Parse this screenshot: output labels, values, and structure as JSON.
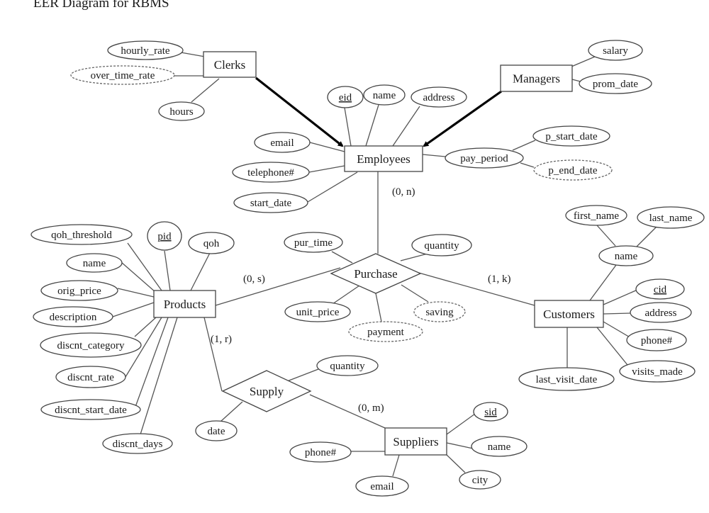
{
  "title": "EER Diagram for RBMS",
  "entities": [
    {
      "id": "clerks",
      "label": "Clerks"
    },
    {
      "id": "managers",
      "label": "Managers"
    },
    {
      "id": "employees",
      "label": "Employees"
    },
    {
      "id": "products",
      "label": "Products"
    },
    {
      "id": "customers",
      "label": "Customers"
    },
    {
      "id": "suppliers",
      "label": "Suppliers"
    }
  ],
  "relationships": [
    {
      "id": "purchase",
      "label": "Purchase",
      "connects": [
        "products",
        "employees",
        "customers"
      ]
    },
    {
      "id": "supply",
      "label": "Supply",
      "connects": [
        "products",
        "suppliers"
      ]
    }
  ],
  "specializations": [
    {
      "from": "clerks",
      "to": "employees"
    },
    {
      "from": "managers",
      "to": "employees"
    }
  ],
  "attributes": [
    {
      "id": "clerks-hourly_rate",
      "owner": "clerks",
      "label": "hourly_rate",
      "key": false,
      "derived": false
    },
    {
      "id": "clerks-over_time_rate",
      "owner": "clerks",
      "label": "over_time_rate",
      "key": false,
      "derived": true
    },
    {
      "id": "clerks-hours",
      "owner": "clerks",
      "label": "hours",
      "key": false,
      "derived": false
    },
    {
      "id": "managers-salary",
      "owner": "managers",
      "label": "salary",
      "key": false,
      "derived": false
    },
    {
      "id": "managers-prom_date",
      "owner": "managers",
      "label": "prom_date",
      "key": false,
      "derived": false
    },
    {
      "id": "employees-eid",
      "owner": "employees",
      "label": "eid",
      "key": true,
      "derived": false
    },
    {
      "id": "employees-name",
      "owner": "employees",
      "label": "name",
      "key": false,
      "derived": false
    },
    {
      "id": "employees-address",
      "owner": "employees",
      "label": "address",
      "key": false,
      "derived": false
    },
    {
      "id": "employees-email",
      "owner": "employees",
      "label": "email",
      "key": false,
      "derived": false
    },
    {
      "id": "employees-telephone",
      "owner": "employees",
      "label": "telephone#",
      "key": false,
      "derived": false
    },
    {
      "id": "employees-start_date",
      "owner": "employees",
      "label": "start_date",
      "key": false,
      "derived": false
    },
    {
      "id": "employees-pay_period",
      "owner": "employees",
      "label": "pay_period",
      "key": false,
      "derived": false
    },
    {
      "id": "pay_period-p_start_date",
      "owner": "employees-pay_period",
      "label": "p_start_date",
      "key": false,
      "derived": false
    },
    {
      "id": "pay_period-p_end_date",
      "owner": "employees-pay_period",
      "label": "p_end_date",
      "key": false,
      "derived": true
    },
    {
      "id": "products-qoh_threshold",
      "owner": "products",
      "label": "qoh_threshold",
      "key": false,
      "derived": false
    },
    {
      "id": "products-pid",
      "owner": "products",
      "label": "pid",
      "key": true,
      "derived": false
    },
    {
      "id": "products-qoh",
      "owner": "products",
      "label": "qoh",
      "key": false,
      "derived": false
    },
    {
      "id": "products-name",
      "owner": "products",
      "label": "name",
      "key": false,
      "derived": false
    },
    {
      "id": "products-orig_price",
      "owner": "products",
      "label": "orig_price",
      "key": false,
      "derived": false
    },
    {
      "id": "products-description",
      "owner": "products",
      "label": "description",
      "key": false,
      "derived": false
    },
    {
      "id": "products-discnt_category",
      "owner": "products",
      "label": "discnt_category",
      "key": false,
      "derived": false
    },
    {
      "id": "products-discnt_rate",
      "owner": "products",
      "label": "discnt_rate",
      "key": false,
      "derived": false
    },
    {
      "id": "products-discnt_start_date",
      "owner": "products",
      "label": "discnt_start_date",
      "key": false,
      "derived": false
    },
    {
      "id": "products-discnt_days",
      "owner": "products",
      "label": "discnt_days",
      "key": false,
      "derived": false
    },
    {
      "id": "purchase-pur_time",
      "owner": "purchase",
      "label": "pur_time",
      "key": false,
      "derived": false
    },
    {
      "id": "purchase-quantity",
      "owner": "purchase",
      "label": "quantity",
      "key": false,
      "derived": false
    },
    {
      "id": "purchase-unit_price",
      "owner": "purchase",
      "label": "unit_price",
      "key": false,
      "derived": false
    },
    {
      "id": "purchase-payment",
      "owner": "purchase",
      "label": "payment",
      "key": false,
      "derived": true
    },
    {
      "id": "purchase-saving",
      "owner": "purchase",
      "label": "saving",
      "key": false,
      "derived": true
    },
    {
      "id": "customers-name",
      "owner": "customers",
      "label": "name",
      "key": false,
      "derived": false
    },
    {
      "id": "name-first_name",
      "owner": "customers-name",
      "label": "first_name",
      "key": false,
      "derived": false
    },
    {
      "id": "name-last_name",
      "owner": "customers-name",
      "label": "last_name",
      "key": false,
      "derived": false
    },
    {
      "id": "customers-cid",
      "owner": "customers",
      "label": "cid",
      "key": true,
      "derived": false
    },
    {
      "id": "customers-address",
      "owner": "customers",
      "label": "address",
      "key": false,
      "derived": false
    },
    {
      "id": "customers-phone",
      "owner": "customers",
      "label": "phone#",
      "key": false,
      "derived": false
    },
    {
      "id": "customers-visits_made",
      "owner": "customers",
      "label": "visits_made",
      "key": false,
      "derived": false
    },
    {
      "id": "customers-last_visit_date",
      "owner": "customers",
      "label": "last_visit_date",
      "key": false,
      "derived": false
    },
    {
      "id": "supply-quantity",
      "owner": "supply",
      "label": "quantity",
      "key": false,
      "derived": false
    },
    {
      "id": "supply-date",
      "owner": "supply",
      "label": "date",
      "key": false,
      "derived": false
    },
    {
      "id": "suppliers-sid",
      "owner": "suppliers",
      "label": "sid",
      "key": true,
      "derived": false
    },
    {
      "id": "suppliers-name",
      "owner": "suppliers",
      "label": "name",
      "key": false,
      "derived": false
    },
    {
      "id": "suppliers-city",
      "owner": "suppliers",
      "label": "city",
      "key": false,
      "derived": false
    },
    {
      "id": "suppliers-phone",
      "owner": "suppliers",
      "label": "phone#",
      "key": false,
      "derived": false
    },
    {
      "id": "suppliers-email",
      "owner": "suppliers",
      "label": "email",
      "key": false,
      "derived": false
    }
  ],
  "cardinalities": [
    {
      "id": "employees-purchase",
      "label": "(0, n)"
    },
    {
      "id": "products-purchase",
      "label": "(0, s)"
    },
    {
      "id": "customers-purchase",
      "label": "(1, k)"
    },
    {
      "id": "products-supply",
      "label": "(1, r)"
    },
    {
      "id": "suppliers-supply",
      "label": "(0, m)"
    }
  ]
}
